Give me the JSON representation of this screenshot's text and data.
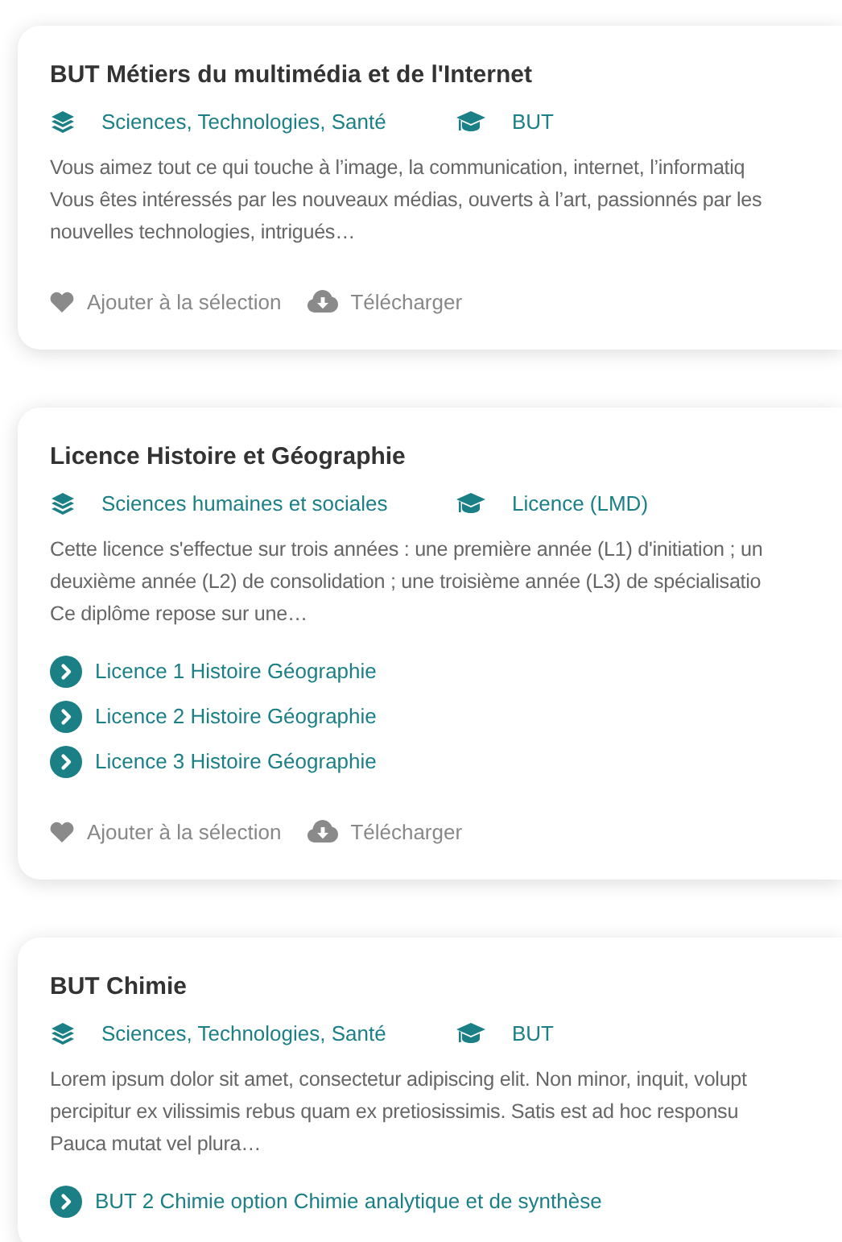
{
  "formations": [
    {
      "title": "BUT Métiers du multimédia et de l'Internet",
      "domain": "Sciences, Technologies, Santé",
      "diploma": "BUT",
      "description_lines": [
        "Vous aimez tout ce qui touche à l’image, la communication, internet, l’informatiq",
        "Vous êtes intéressés par les nouveaux médias, ouverts à l’art, passionnés par les",
        "nouvelles technologies, intrigués…"
      ],
      "actions": [
        "Ajouter à la sélection",
        "Télécharger"
      ]
    },
    {
      "title": "Licence Histoire et Géographie",
      "domain": "Sciences humaines et sociales",
      "diploma": "Licence",
      "diploma_note": " (LMD)",
      "description_lines": [
        "Cette licence s'effectue sur trois années : une première année (L1) d'initiation ; un",
        "deuxième année (L2) de consolidation ; une troisième année (L3) de spécialisatio",
        "Ce diplôme repose sur une…"
      ],
      "parcours": [
        "Licence 1 Histoire Géographie",
        "Licence 2 Histoire Géographie",
        "Licence 3 Histoire Géographie"
      ],
      "actions": [
        "Ajouter à la sélection",
        "Télécharger"
      ]
    },
    {
      "title": "BUT Chimie",
      "domain": "Sciences, Technologies, Santé",
      "diploma": "BUT",
      "description_lines": [
        "Lorem ipsum dolor sit amet, consectetur adipiscing elit. Non minor, inquit, volupt",
        "percipitur ex vilissimis rebus quam ex pretiosissimis.  Satis est ad hoc responsu",
        "Pauca mutat vel plura…"
      ],
      "parcours": [
        "BUT 2 Chimie option Chimie analytique et de synthèse"
      ]
    }
  ]
}
